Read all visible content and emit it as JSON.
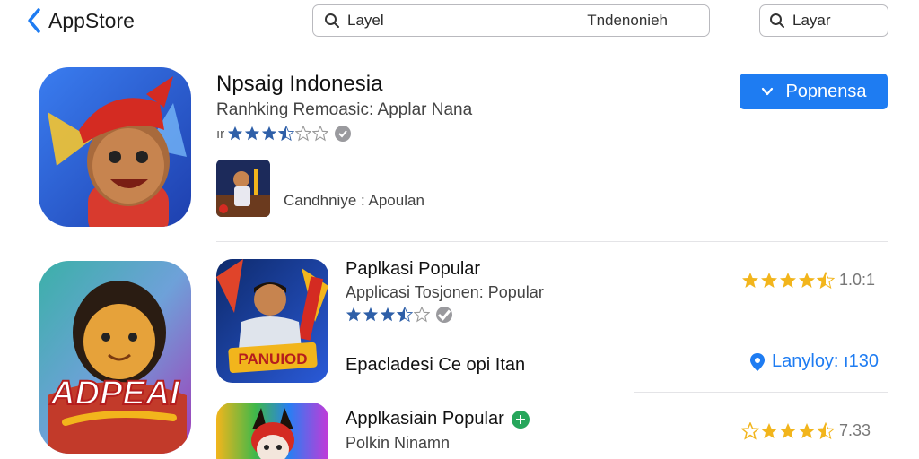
{
  "header": {
    "back_label": "AppStore",
    "search_main_query": "Layel",
    "search_main_region": "Tndenonieh",
    "search_side_query": "Layar"
  },
  "featured": {
    "title": "Npsaig Indonesia",
    "subtitle": "Ranhking Remoasic: Applar Nana",
    "stars_prefix": "ır",
    "rating_stars": 3.5,
    "get_label": "Popnensa",
    "caption": "Candhniye : Apoulan"
  },
  "list": [
    {
      "title": "Paplkasi Popular",
      "subtitle": "Applicasi Tosjonen: Popular",
      "rating_stars": 3.5,
      "rating_value": "1.0:1",
      "caption": "Epacladesi Ce opi Itan",
      "location_label": "Lanyloy: ı130",
      "icon_text": "PANUIOD"
    },
    {
      "title": "Applkasiain Popular",
      "subtitle": "Polkin Ninamn",
      "rating_value": "7.33"
    }
  ],
  "side_icon_text": "ADPEAI",
  "colors": {
    "accent": "#1e7cf2",
    "star_blue": "#2e5fa8",
    "star_gold": "#f2b51c",
    "verified_green": "#26a65b"
  }
}
